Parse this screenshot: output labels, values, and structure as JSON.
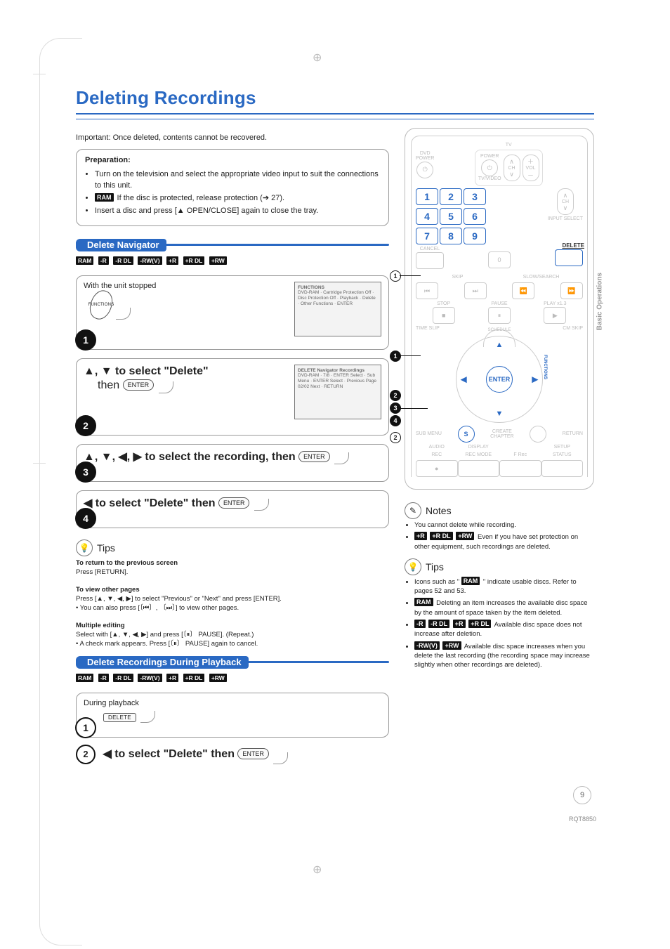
{
  "page": {
    "title": "Deleting Recordings",
    "important": "Important: Once deleted, contents cannot be recovered.",
    "side_tab": "Basic Operations",
    "page_number": "9",
    "doc_code": "RQT8850"
  },
  "prep": {
    "heading": "Preparation:",
    "item1": "Turn on the television and select the appropriate video input to suit the connections to this unit.",
    "item2_tag": "RAM",
    "item2_text": " If the disc is protected, release protection (➔ 27).",
    "item3": "Insert a disc and press [▲ OPEN/CLOSE] again to close the tray."
  },
  "disc_tags": {
    "ram": "RAM",
    "r": "-R",
    "rdl": "-R DL",
    "rwv": "-RW(V)",
    "pr": "+R",
    "prdl": "+R DL",
    "prw": "+RW"
  },
  "navigator": {
    "heading": "Delete Navigator",
    "step1_label": "With the unit stopped",
    "functions_screenshot_title": "FUNCTIONS",
    "functions_lines": "DVD-RAM · Cartridge Protection Off · Disc Protection Off · Playback · Delete · Other Functions · ENTER",
    "delnav_screenshot_title": "DELETE Navigator    Recordings",
    "delnav_info": "DVD-RAM · 7/8 · ENTER Select · Sub Menu · ENTER Select · Previous Page 02/02 Next · RETURN",
    "step2_line1": "▲, ▼ to select \"Delete\"",
    "step2_line2": "then ",
    "step3_text": "▲, ▼, ◀, ▶ to select the recording, then ",
    "step4_text": "◀ to select \"Delete\" then ",
    "enter_label": "ENTER"
  },
  "tips_left": {
    "heading": "Tips",
    "t1_b": "To return to the previous screen",
    "t1": "Press [RETURN].",
    "t2_b": "To view other pages",
    "t2a": "Press [▲, ▼, ◀, ▶] to select \"Previous\" or \"Next\" and press [ENTER].",
    "t2b": "• You can also press [〔⏮〕, 〔⏭〕] to view other pages.",
    "t3_b": "Multiple editing",
    "t3a": "Select with [▲, ▼, ◀, ▶] and press [〔⏸〕 PAUSE]. (Repeat.)",
    "t3b": "• A check mark appears. Press [〔⏸〕 PAUSE] again to cancel."
  },
  "playback": {
    "heading": "Delete Recordings During Playback",
    "step1_label": "During playback",
    "delete_key": "DELETE",
    "step2_text": "◀ to select \"Delete\" then ",
    "enter_label": "ENTER"
  },
  "remote": {
    "dvd_power": "DVD\nPOWER",
    "tv": "TV",
    "power": "POWER",
    "tvvideo": "TV/VIDEO",
    "ch": "CH",
    "vol": "VOL",
    "cancel": "CANCEL",
    "input_select": "INPUT SELECT",
    "delete_label": "DELETE",
    "skip": "SKIP",
    "slow": "SLOW/SEARCH",
    "stop": "STOP",
    "pause": "PAUSE",
    "play": "PLAY x1.3",
    "timeslip": "TIME SLIP",
    "cmskip": "CM SKIP",
    "schedule": "SCHEDULE",
    "functions": "FUNCTIONS",
    "enter": "ENTER",
    "submenu": "SUB MENU",
    "return": "RETURN",
    "s": "S",
    "create_chapter": "CREATE\nCHAPTER",
    "audio": "AUDIO",
    "display": "DISPLAY",
    "setup": "SETUP",
    "rec": "REC",
    "recmode": "REC MODE",
    "frec": "F Rec",
    "status": "STATUS",
    "keypad": [
      "1",
      "2",
      "3",
      "4",
      "5",
      "6",
      "7",
      "8",
      "9"
    ]
  },
  "notes_right": {
    "heading": "Notes",
    "n1": "You cannot delete while recording.",
    "n2_tags": {
      "a": "+R",
      "b": "+R DL",
      "c": "+RW"
    },
    "n2": " Even if you have set protection on other equipment, such recordings are deleted."
  },
  "tips_right": {
    "heading": "Tips",
    "t1a": "Icons such as \" ",
    "t1tag": "RAM",
    "t1b": " \" indicate usable discs. Refer to pages 52 and 53.",
    "t2tag": "RAM",
    "t2": " Deleting an item increases the available disc space by the amount of space taken by the item deleted.",
    "t3tags": {
      "a": "-R",
      "b": "-R DL",
      "c": "+R",
      "d": "+R DL"
    },
    "t3": " Available disc space does not increase after deletion.",
    "t4tags": {
      "a": "-RW(V)",
      "b": "+RW"
    },
    "t4": " Available disc space increases when you delete the last recording (the recording space may increase slightly when other recordings are deleted)."
  }
}
